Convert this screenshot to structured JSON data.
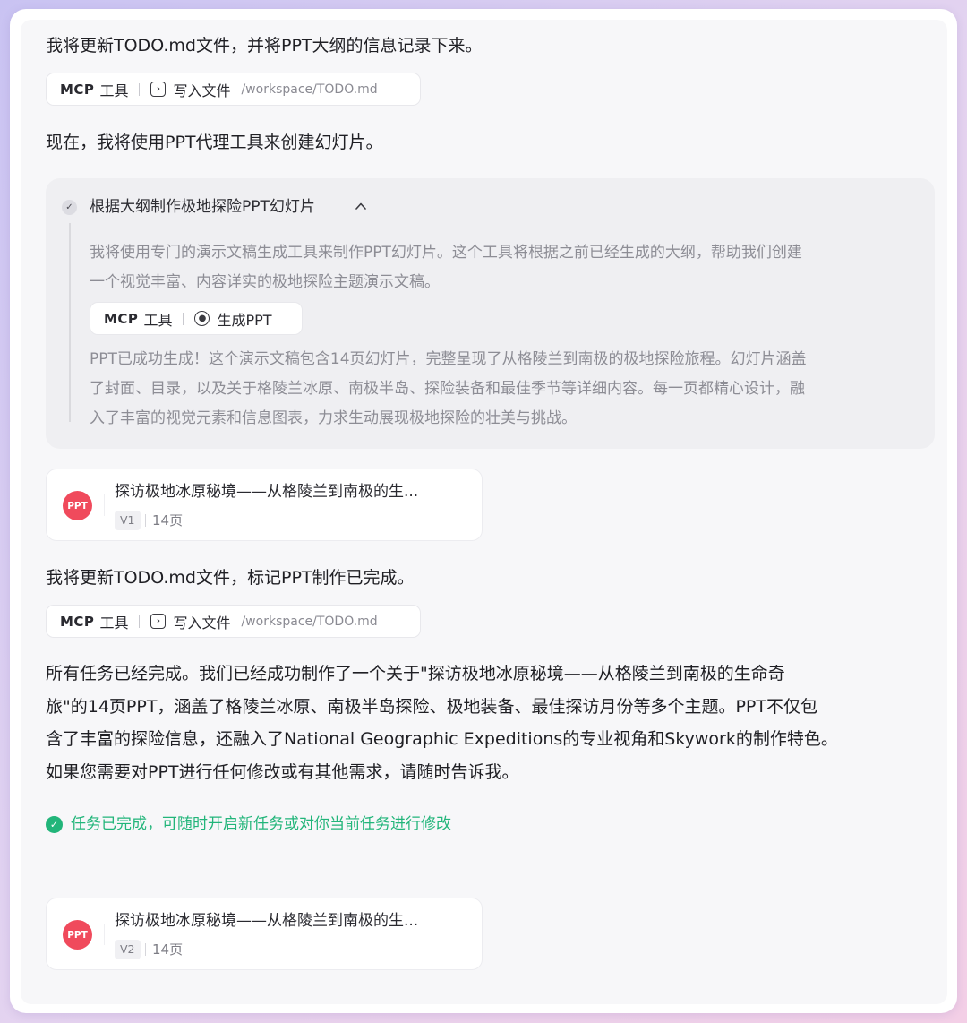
{
  "messages": {
    "m1": "我将更新TODO.md文件，并将PPT大纲的信息记录下来。",
    "m2": "现在，我将使用PPT代理工具来创建幻灯片。",
    "m3": "我将更新TODO.md文件，标记PPT制作已完成。",
    "summary": [
      "所有任务已经完成。我们已经成功制作了一个关于\"探访极地冰原秘境——从格陵兰到南极的生命奇",
      "旅\"的14页PPT，涵盖了格陵兰冰原、南极半岛探险、极地装备、最佳探访月份等多个主题。PPT不仅包",
      "含了丰富的探险信息，还融入了National Geographic Expeditions的专业视角和Skywork的制作特色。",
      "如果您需要对PPT进行任何修改或有其他需求，请随时告诉我。"
    ]
  },
  "chips": {
    "write1": {
      "mcp": "MCP",
      "tool": "工具",
      "icon": "terminal-icon",
      "action": "写入文件",
      "path": "/workspace/TODO.md"
    },
    "gen": {
      "mcp": "MCP",
      "tool": "工具",
      "icon": "ppt-gen-icon",
      "action": "生成PPT"
    },
    "write2": {
      "mcp": "MCP",
      "tool": "工具",
      "icon": "terminal-icon",
      "action": "写入文件",
      "path": "/workspace/TODO.md"
    }
  },
  "thinking": {
    "title": "根据大纲制作极地探险PPT幻灯片",
    "intro": [
      "我将使用专门的演示文稿生成工具来制作PPT幻灯片。这个工具将根据之前已经生成的大纲，帮助我们创建",
      "一个视觉丰富、内容详实的极地探险主题演示文稿。"
    ],
    "result": [
      "PPT已成功生成！这个演示文稿包含14页幻灯片，完整呈现了从格陵兰到南极的极地探险旅程。幻灯片涵盖",
      "了封面、目录，以及关于格陵兰冰原、南极半岛、探险装备和最佳季节等详细内容。每一页都精心设计，融",
      "入了丰富的视觉元素和信息图表，力求生动展现极地探险的壮美与挑战。"
    ]
  },
  "cards": [
    {
      "logo": "PPT",
      "title": "探访极地冰原秘境——从格陵兰到南极的生...",
      "version": "V1",
      "pages": "14页"
    },
    {
      "logo": "PPT",
      "title": "探访极地冰原秘境——从格陵兰到南极的生...",
      "version": "V2",
      "pages": "14页"
    }
  ],
  "status": {
    "text": "任务已完成，可随时开启新任务或对你当前任务进行修改",
    "color": "#22b57a"
  },
  "colors": {
    "ppt_logo": "#f04a5c",
    "background_gradient": [
      "#c9c3f2",
      "#f3cfe6"
    ]
  }
}
